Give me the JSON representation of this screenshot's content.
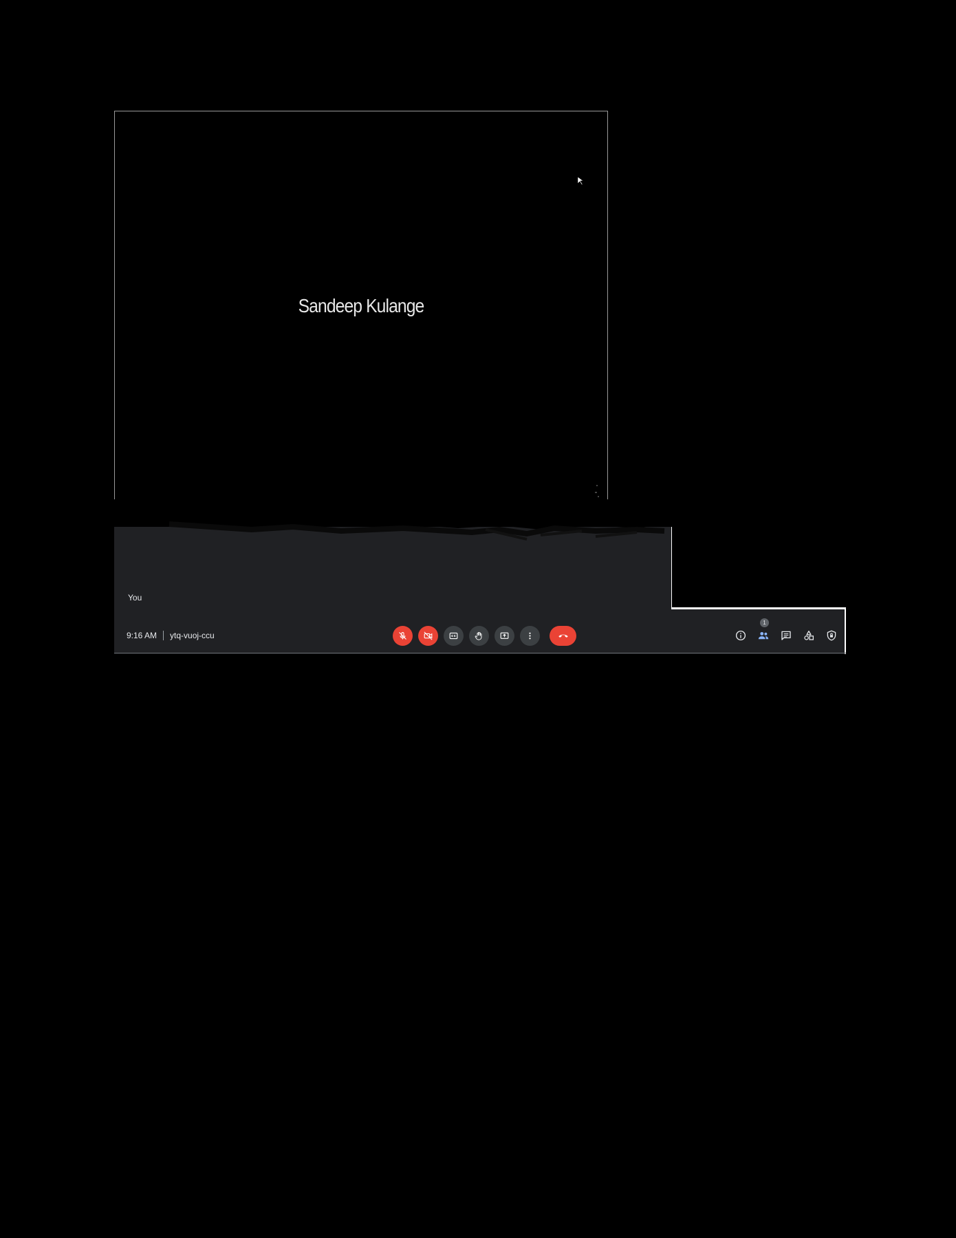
{
  "share": {
    "presenter_name": "Sandeep Kulange"
  },
  "tile": {
    "self_label": "You"
  },
  "meeting": {
    "time": "9:16 AM",
    "code": "ytq-vuoj-ccu"
  },
  "controls": {
    "mic": {
      "state": "off",
      "icon": "mic-off-icon"
    },
    "camera": {
      "state": "off",
      "icon": "videocam-off-icon"
    },
    "captions": {
      "icon": "closed-captions-icon"
    },
    "raise_hand": {
      "icon": "hand-icon"
    },
    "present": {
      "icon": "present-screen-icon"
    },
    "more": {
      "icon": "more-vert-icon"
    },
    "end_call": {
      "icon": "call-end-icon"
    }
  },
  "side_controls": {
    "people_count": "1"
  },
  "colors": {
    "panel_bg": "#202124",
    "danger": "#ea4335",
    "button_bg": "#3c4043",
    "people_accent": "#8ab4f8"
  }
}
